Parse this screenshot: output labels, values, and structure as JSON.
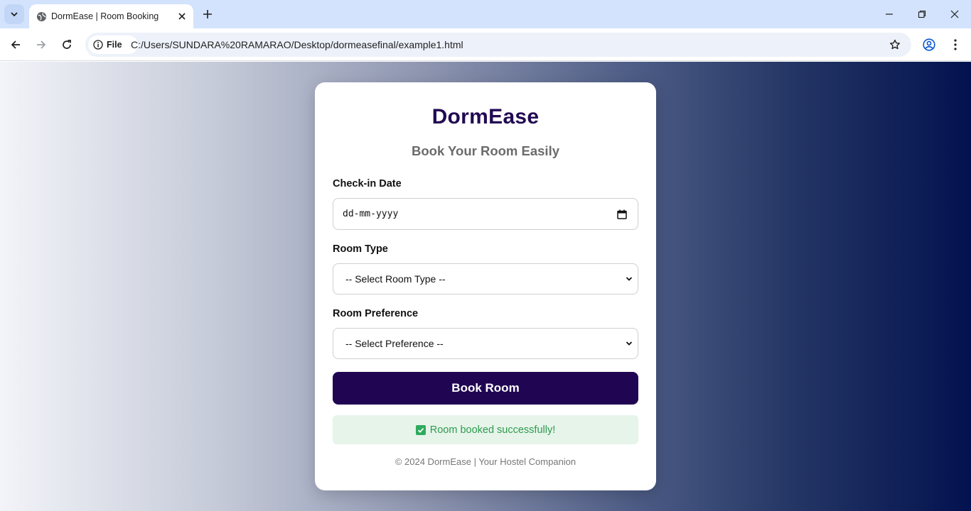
{
  "browser": {
    "tab_title": "DormEase | Room Booking",
    "chip_label": "File",
    "url": "C:/Users/SUNDARA%20RAMARAO/Desktop/dormeasefinal/example1.html",
    "icons": [
      "tab-search-icon",
      "globe-icon",
      "close-icon",
      "plus-icon",
      "minimize-icon",
      "restore-icon",
      "window-close-icon",
      "back-arrow-icon",
      "forward-arrow-icon",
      "reload-icon",
      "info-icon",
      "star-icon",
      "profile-icon",
      "more-vert-icon"
    ]
  },
  "page": {
    "brand": "DormEase",
    "subtitle": "Book Your Room Easily",
    "checkin": {
      "label": "Check-in Date",
      "value": "dd-mm-yyyy"
    },
    "room_type": {
      "label": "Room Type",
      "selected": "-- Select Room Type --"
    },
    "room_preference": {
      "label": "Room Preference",
      "selected": "-- Select Preference --"
    },
    "book_button": "Book Room",
    "success_message": "Room booked successfully!",
    "footer": "© 2024 DormEase | Your Hostel Companion"
  },
  "colors": {
    "brand": "#220a52",
    "button": "#200652",
    "success_bg": "#e6f4ea",
    "success_text": "#2e9a4e",
    "gradient_start": "#f3f4f9",
    "gradient_end": "#03124f"
  }
}
